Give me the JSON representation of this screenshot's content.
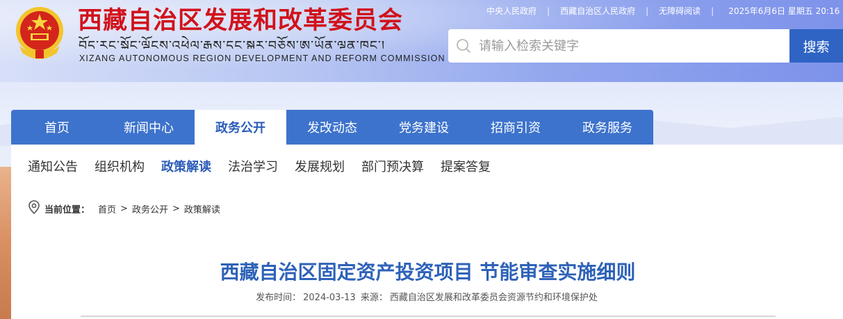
{
  "header": {
    "org_title_cn": "西藏自治区发展和改革委员会",
    "org_title_tibetan": "བོད་རང་སྐྱོང་ལྗོངས་འཕེལ་རྒྱས་དང་སྒྱུར་བཅོས་ཨུ་ཡོན་ལྷན་ཁང་།",
    "org_title_en": "XIZANG AUTONOMOUS REGION DEVELOPMENT AND REFORM COMMISSION",
    "top_links": [
      "中央人民政府",
      "西藏自治区人民政府",
      "无障碍阅读"
    ],
    "separator": "|",
    "date_text": "2025年6月6日 星期五 20:16",
    "emblem_icon": "national-emblem-icon"
  },
  "search": {
    "placeholder": "请输入检索关键字",
    "button_label": "搜索"
  },
  "main_nav": {
    "items": [
      {
        "label": "首页",
        "active": false
      },
      {
        "label": "新闻中心",
        "active": false
      },
      {
        "label": "政务公开",
        "active": true
      },
      {
        "label": "发改动态",
        "active": false
      },
      {
        "label": "党务建设",
        "active": false
      },
      {
        "label": "招商引资",
        "active": false
      },
      {
        "label": "政务服务",
        "active": false
      }
    ]
  },
  "sub_nav": {
    "items": [
      {
        "label": "通知公告",
        "active": false
      },
      {
        "label": "组织机构",
        "active": false
      },
      {
        "label": "政策解读",
        "active": true
      },
      {
        "label": "法治学习",
        "active": false
      },
      {
        "label": "发展规划",
        "active": false
      },
      {
        "label": "部门预决算",
        "active": false
      },
      {
        "label": "提案答复",
        "active": false
      }
    ]
  },
  "breadcrumb": {
    "label": "当前位置：",
    "items": [
      "首页",
      "政务公开",
      "政策解读"
    ],
    "separator": ">",
    "icon": "location-pin-icon"
  },
  "article": {
    "title": "西藏自治区固定资产投资项目 节能审查实施细则",
    "publish_label": "发布时间：",
    "publish_date": "2024-03-13",
    "source_label": "来源：",
    "source": "西藏自治区发展和改革委员会资源节约和环境保护处"
  },
  "colors": {
    "brand_red": "#d1121b",
    "nav_blue": "#3d73cc",
    "title_blue": "#2e62b8",
    "search_button": "#2f64c4"
  }
}
